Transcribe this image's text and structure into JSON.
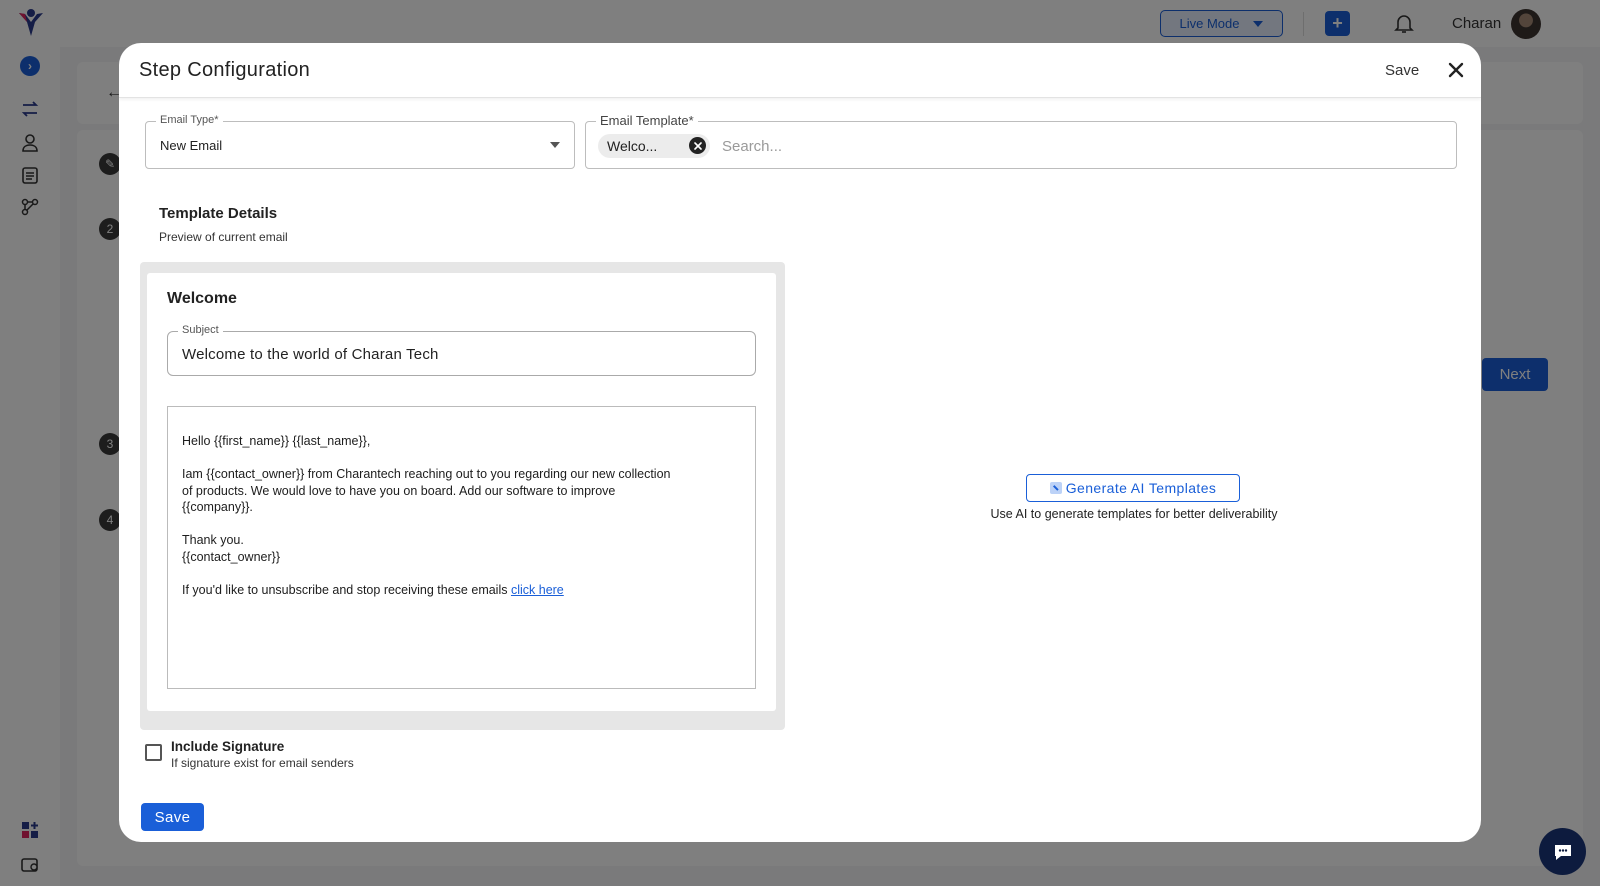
{
  "app": {
    "live_mode_label": "Live Mode",
    "user_name": "Charan",
    "next_label": "Next",
    "steps": [
      "2",
      "3",
      "4"
    ],
    "accent_color": "#1a5fd8"
  },
  "modal": {
    "title": "Step Configuration",
    "save_label": "Save",
    "email_type": {
      "label": "Email Type*",
      "value": "New Email"
    },
    "email_template": {
      "label": "Email Template*",
      "chip": "Welco...",
      "search_placeholder": "Search..."
    },
    "template_details": {
      "title": "Template Details",
      "subtitle": "Preview of current email"
    },
    "preview": {
      "name": "Welcome",
      "subject_label": "Subject",
      "subject_value": "Welcome to the world of Charan Tech",
      "body": {
        "greeting": "Hello {{first_name}} {{last_name}},",
        "line1": "Iam {{contact_owner}} from Charantech reaching out to you regarding our new collection",
        "line2": "of products. We would love to have you on board. Add our software to improve",
        "line3": "{{company}}.",
        "thanks": "Thank you.",
        "signoff": "{{contact_owner}}",
        "unsub_text": "If you'd like to unsubscribe and stop receiving these emails ",
        "unsub_link": "click here"
      }
    },
    "ai": {
      "button_label": "Generate AI Templates",
      "subtitle": "Use AI to generate templates for better deliverability"
    },
    "signature": {
      "label": "Include Signature",
      "subtitle": "If signature exist for email senders",
      "checked": false
    },
    "footer_save_label": "Save"
  }
}
